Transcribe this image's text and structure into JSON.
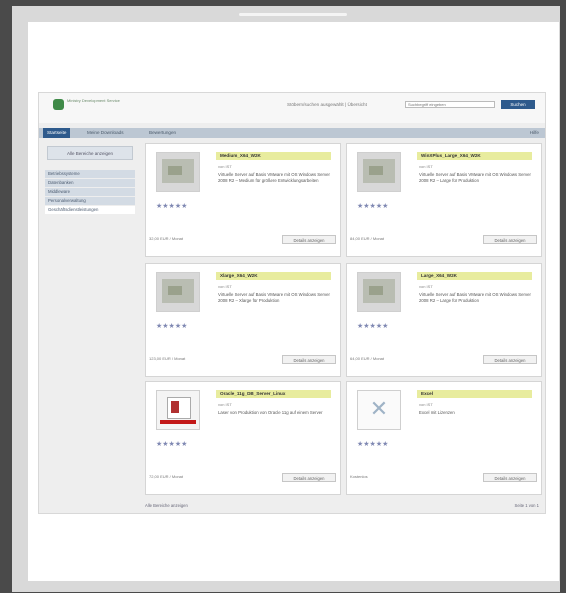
{
  "header": {
    "logo_text": "Ministry Development Service",
    "search_label": "Stöbern/suchen ausgewählt | Übersicht",
    "search_placeholder": "Suchbegriff eingeben",
    "search_button": "Suchen",
    "icon": "ministry-logo"
  },
  "tabs": [
    {
      "label": "Startseite",
      "active": true
    },
    {
      "label": "Meine Downloads",
      "active": false
    },
    {
      "label": "Bewertungen",
      "active": false
    }
  ],
  "help_label": "Hilfe",
  "sidebar": {
    "button": "Alle Bereiche anzeigen",
    "items": [
      {
        "label": "Betriebssysteme",
        "selected": false
      },
      {
        "label": "Datenbanken",
        "selected": false
      },
      {
        "label": "Middleware",
        "selected": false
      },
      {
        "label": "Personalverwaltung",
        "selected": false
      },
      {
        "label": "Geschäftsdienstleistungen",
        "selected": true
      }
    ]
  },
  "cards": [
    {
      "title": "Medium_X64_W2K",
      "by": "von IST",
      "desc": "Virtuelle Server auf Basis VMware mit OS Windows Server 2008 R2 – Medium für größere Entwicklungsarbeiten",
      "footer": "32,00 EUR / Monat",
      "button": "Details anzeigen",
      "thumb": "screenshot",
      "rating": 5
    },
    {
      "title": "WinXPlus_Large_X64_W2K",
      "by": "von IST",
      "desc": "Virtuelle Server auf Basis VMware mit OS Windows Server 2008 R2 – Large für Produktion",
      "footer": "84,00 EUR / Monat",
      "button": "Details anzeigen",
      "thumb": "screenshot",
      "rating": 5
    },
    {
      "title": "Xlarge_X64_W2K",
      "by": "von IST",
      "desc": "Virtuelle Server auf Basis VMware mit OS Windows Server 2008 R2 – Xlarge für Produktion",
      "footer": "123,00 EUR / Monat",
      "button": "Details anzeigen",
      "thumb": "screenshot",
      "rating": 5
    },
    {
      "title": "Large_X64_W2K",
      "by": "von IST",
      "desc": "Virtuelle Server auf Basis VMware mit OS Windows Server 2008 R2 – Large für Produktion",
      "footer": "64,00 EUR / Monat",
      "button": "Details anzeigen",
      "thumb": "screenshot",
      "rating": 5
    },
    {
      "title": "Oracle_11g_DB_Server_Linux",
      "by": "von IST",
      "desc": "Laser von Produktion von Oracle 11g auf einem Server",
      "footer": "72,00 EUR / Monat",
      "button": "Details anzeigen",
      "thumb": "oracle",
      "rating": 5
    },
    {
      "title": "Excel",
      "by": "von IST",
      "desc": "Excel mit Lizenzen",
      "footer": "Kostenlos",
      "button": "Details anzeigen",
      "thumb": "xml",
      "rating": 5
    }
  ],
  "bottom": {
    "left": "Alle Bereiche anzeigen",
    "right": "Seite 1 von 1"
  },
  "colors": {
    "accent": "#2e5a8c",
    "title_highlight": "#e8ec9e",
    "star": "#8089b3"
  }
}
